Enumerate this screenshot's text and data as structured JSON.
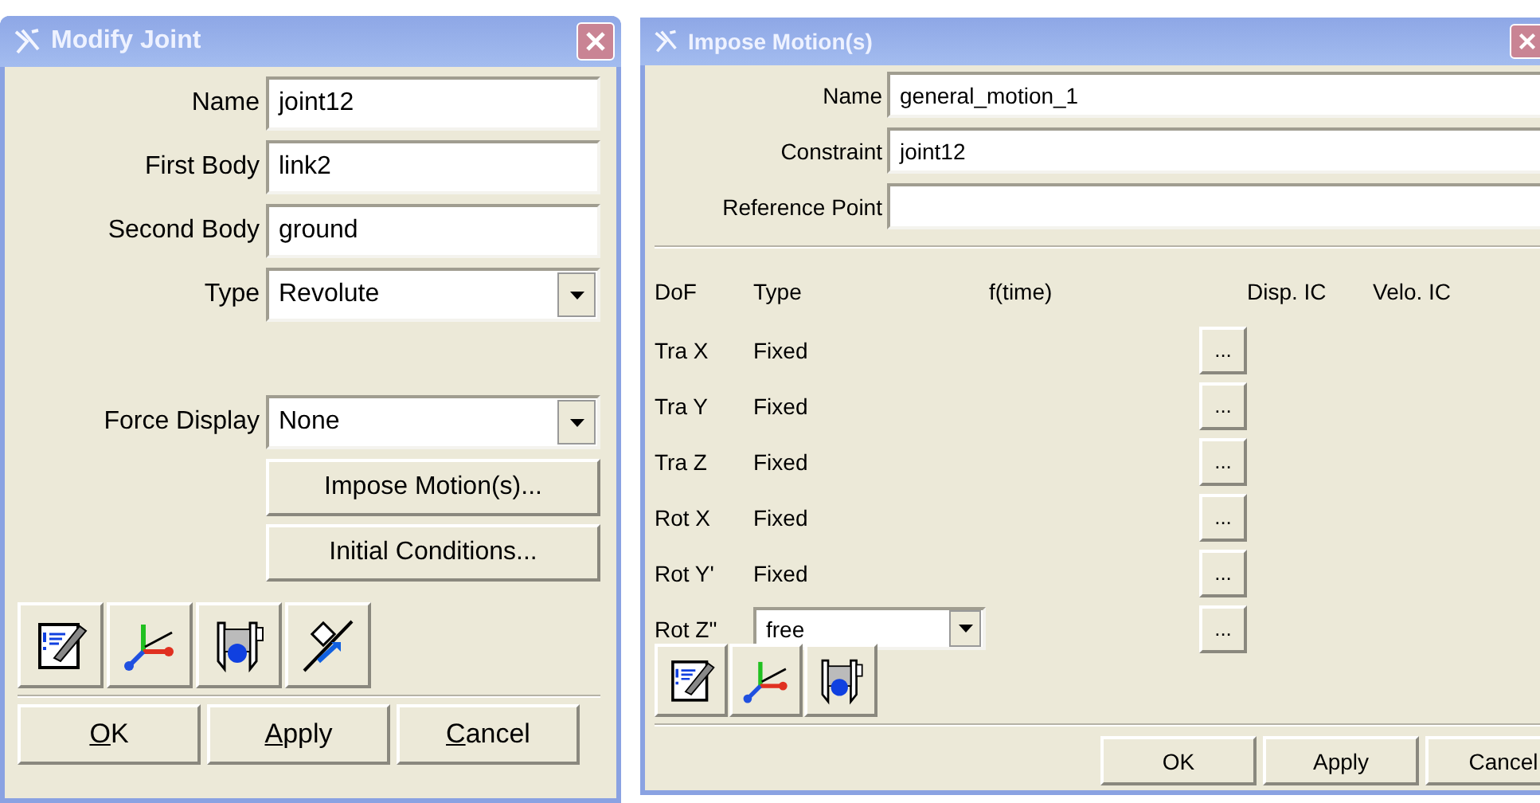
{
  "left_dialog": {
    "title": "Modify Joint",
    "fields": [
      {
        "label": "Name",
        "value": "joint12",
        "kind": "text"
      },
      {
        "label": "First Body",
        "value": "link2",
        "kind": "text"
      },
      {
        "label": "Second Body",
        "value": "ground",
        "kind": "text"
      },
      {
        "label": "Type",
        "value": "Revolute",
        "kind": "dropdown"
      }
    ],
    "force_display": {
      "label": "Force Display",
      "value": "None",
      "kind": "dropdown"
    },
    "action_buttons": [
      "Impose Motion(s)...",
      "Initial Conditions..."
    ],
    "tools": [
      {
        "kind": "notes"
      },
      {
        "kind": "axes"
      },
      {
        "kind": "caliper"
      },
      {
        "kind": "friction"
      }
    ],
    "buttons": [
      {
        "label": "OK",
        "underline_first": true
      },
      {
        "label": "Apply",
        "underline_first": true
      },
      {
        "label": "Cancel",
        "underline_first": true
      }
    ]
  },
  "right_dialog": {
    "title": "Impose Motion(s)",
    "fields": [
      {
        "label": "Name",
        "value": "general_motion_1"
      },
      {
        "label": "Constraint",
        "value": "joint12"
      },
      {
        "label": "Reference Point"
      }
    ],
    "columns": [
      "DoF",
      "Type",
      "f(time)",
      "Disp. IC",
      "Velo. IC"
    ],
    "rows": [
      {
        "dof": "Tra X",
        "type": "Fixed",
        "kind": "text",
        "button": "..."
      },
      {
        "dof": "Tra Y",
        "type": "Fixed",
        "kind": "text",
        "button": "..."
      },
      {
        "dof": "Tra Z",
        "type": "Fixed",
        "kind": "text",
        "button": "..."
      },
      {
        "dof": "Rot X",
        "type": "Fixed",
        "kind": "text",
        "button": "..."
      },
      {
        "dof": "Rot Y'",
        "type": "Fixed",
        "kind": "text",
        "button": "..."
      },
      {
        "dof": "Rot Z\"",
        "type": "free",
        "kind": "dropdown",
        "button": "..."
      }
    ],
    "tools": [
      {
        "kind": "notes"
      },
      {
        "kind": "axes"
      },
      {
        "kind": "caliper"
      }
    ],
    "buttons": [
      {
        "label": "OK",
        "underline_first": false
      },
      {
        "label": "Apply",
        "underline_first": false
      },
      {
        "label": "Cancel",
        "underline_first": false
      }
    ]
  }
}
